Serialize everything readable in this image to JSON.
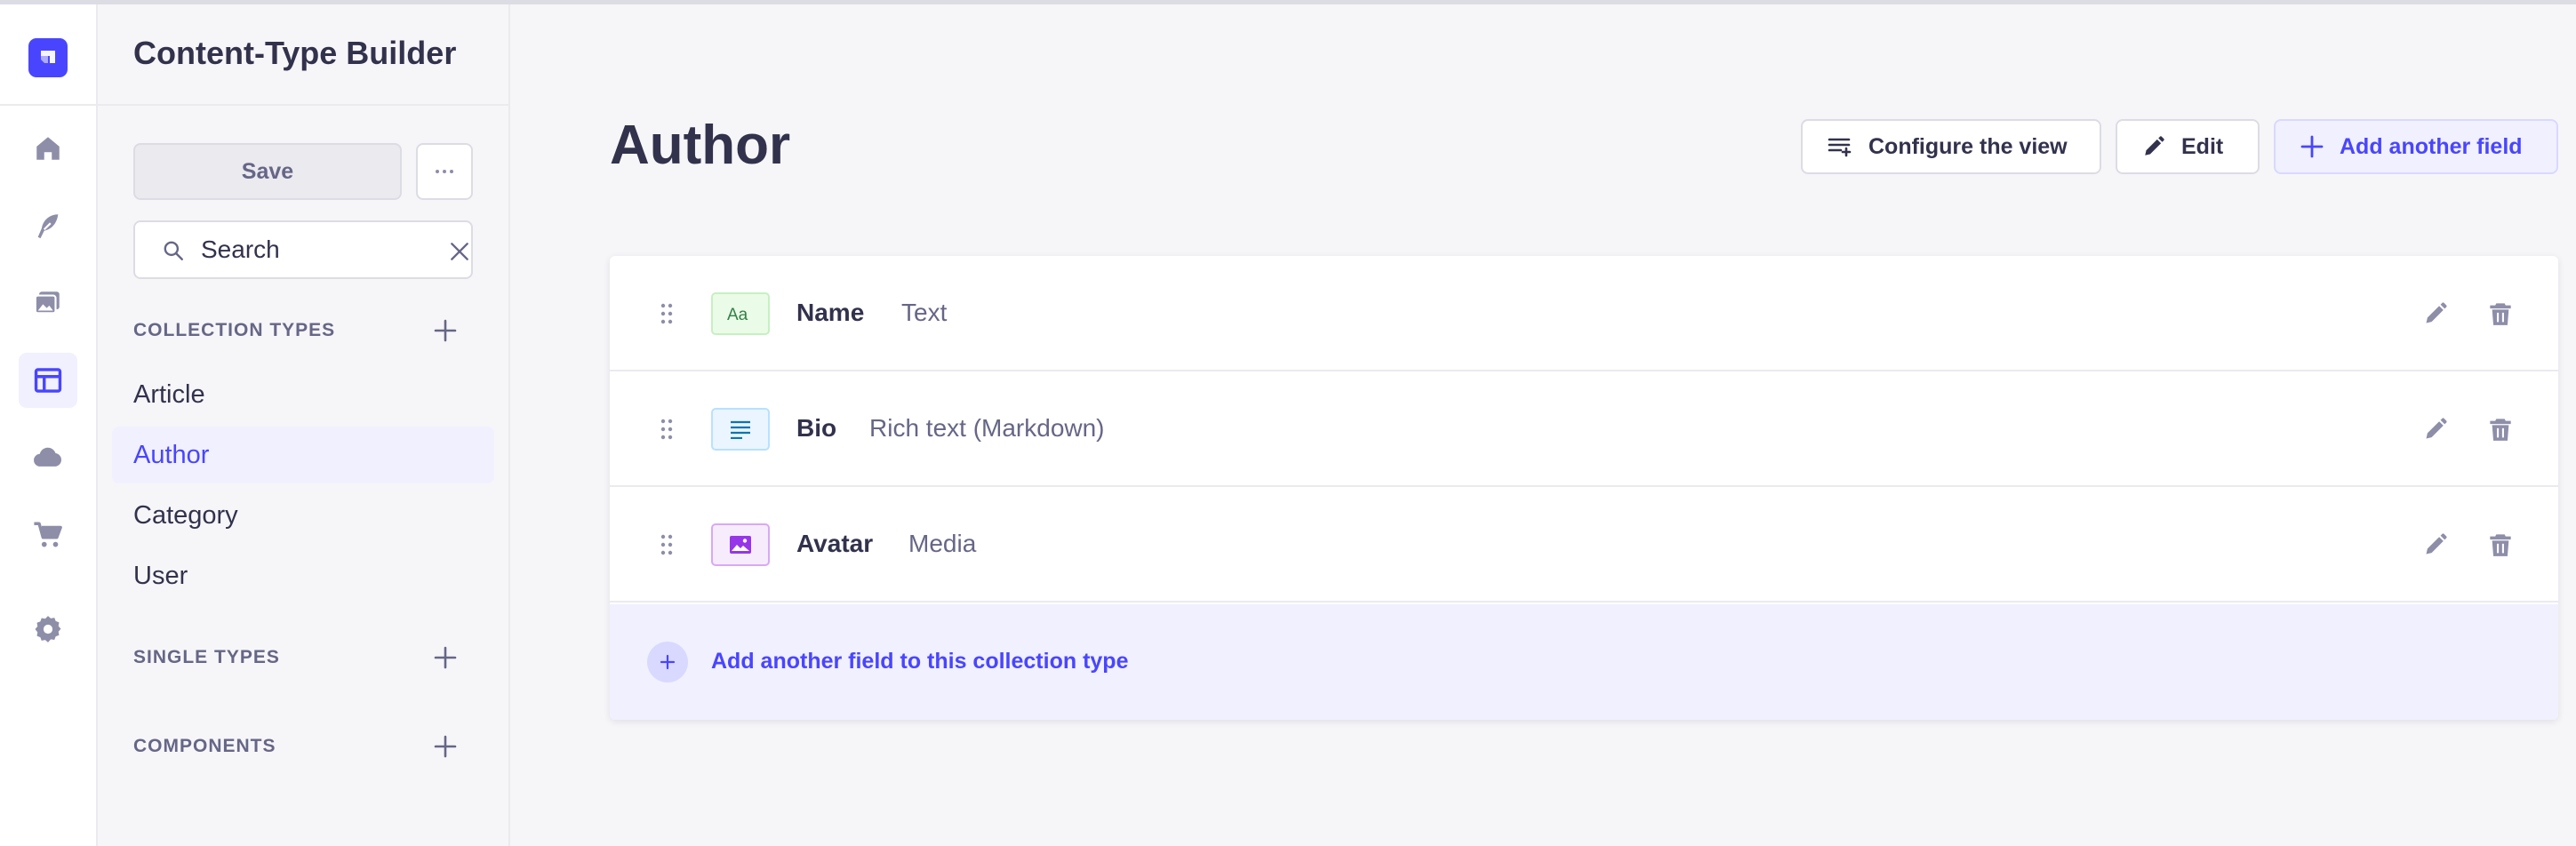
{
  "sidebar": {
    "title": "Content-Type Builder",
    "save_label": "Save",
    "search": {
      "placeholder": "Search",
      "value": ""
    },
    "collection_types": {
      "heading": "COLLECTION TYPES",
      "items": [
        {
          "label": "Article",
          "active": false
        },
        {
          "label": "Author",
          "active": true
        },
        {
          "label": "Category",
          "active": false
        },
        {
          "label": "User",
          "active": false
        }
      ]
    },
    "single_types": {
      "heading": "SINGLE TYPES"
    },
    "components": {
      "heading": "COMPONENTS"
    }
  },
  "main": {
    "title": "Author",
    "actions": {
      "configure": "Configure the view",
      "edit": "Edit",
      "add_field": "Add another field"
    },
    "fields": [
      {
        "name": "Name",
        "type": "Text",
        "icon": "text-field-icon"
      },
      {
        "name": "Bio",
        "type": "Rich text (Markdown)",
        "icon": "richtext-field-icon"
      },
      {
        "name": "Avatar",
        "type": "Media",
        "icon": "media-field-icon"
      }
    ],
    "add_field_row": "Add another field to this collection type"
  },
  "colors": {
    "primary": "#4945ff",
    "primary_light": "#f0f0ff",
    "text": "#32324d",
    "muted": "#666687"
  }
}
